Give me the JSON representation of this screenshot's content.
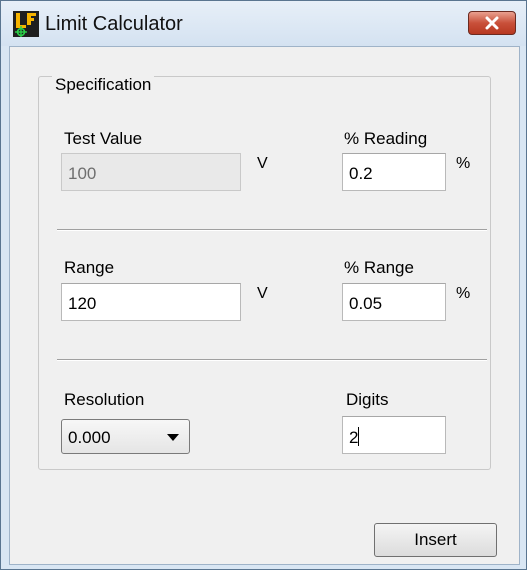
{
  "window": {
    "title": "Limit Calculator",
    "close_icon": "close-x-icon",
    "app_icon": "limit-calculator-app-icon"
  },
  "group": {
    "legend": "Specification"
  },
  "test_value": {
    "label": "Test Value",
    "value": "100",
    "unit": "V"
  },
  "percent_reading": {
    "label": "% Reading",
    "value": "0.2",
    "unit": "%"
  },
  "range": {
    "label": "Range",
    "value": "120",
    "unit": "V"
  },
  "percent_range": {
    "label": "% Range",
    "value": "0.05",
    "unit": "%"
  },
  "resolution": {
    "label": "Resolution",
    "selected": "0.000",
    "icon": "dropdown-arrow-icon"
  },
  "digits": {
    "label": "Digits",
    "value": "2"
  },
  "actions": {
    "insert_label": "Insert"
  },
  "colors": {
    "close_button": "#c9503a",
    "window_frame": "#d9e6f3",
    "dialog_background": "#f0f0f0"
  }
}
